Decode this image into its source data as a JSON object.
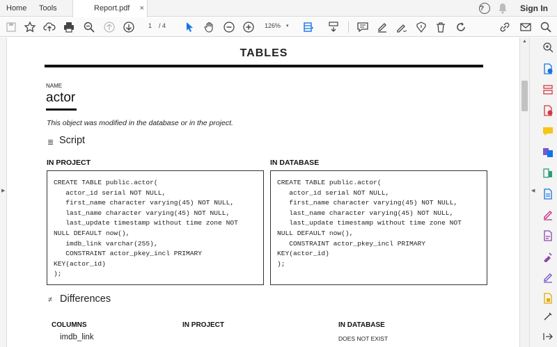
{
  "tabs": {
    "home": "Home",
    "tools": "Tools",
    "document": "Report.pdf",
    "close": "×"
  },
  "header": {
    "help": "?",
    "sign_in": "Sign In"
  },
  "toolbar": {
    "page_current": "1",
    "page_total": "/ 4",
    "zoom": "126%",
    "zoom_caret": "▾"
  },
  "icons": {
    "accent": "#1473e6"
  },
  "document": {
    "title": "TABLES",
    "name_label": "NAME",
    "name_value": "actor",
    "notice": "This object was modified in the database or in the project.",
    "script_icon": "≣",
    "script_heading": "Script",
    "in_project_heading": "IN PROJECT",
    "in_database_heading": "IN DATABASE",
    "project_script": "CREATE TABLE public.actor(\n   actor_id serial NOT NULL,\n   first_name character varying(45) NOT NULL,\n   last_name character varying(45) NOT NULL,\n   last_update timestamp without time zone NOT\nNULL DEFAULT now(),\n   imdb_link varchar(255),\n   CONSTRAINT actor_pkey_incl PRIMARY\nKEY(actor_id)\n);",
    "database_script": "CREATE TABLE public.actor(\n   actor_id serial NOT NULL,\n   first_name character varying(45) NOT NULL,\n   last_name character varying(45) NOT NULL,\n   last_update timestamp without time zone NOT\nNULL DEFAULT now(),\n   CONSTRAINT actor_pkey_incl PRIMARY\nKEY(actor_id)\n);",
    "differences_icon": "≠",
    "differences_heading": "Differences",
    "columns_heading": "COLUMNS",
    "diff_in_project_heading": "IN PROJECT",
    "diff_in_database_heading": "IN DATABASE",
    "diff_row": {
      "column": "imdb_link",
      "in_project": "",
      "in_database": "DOES NOT EXIST"
    }
  }
}
